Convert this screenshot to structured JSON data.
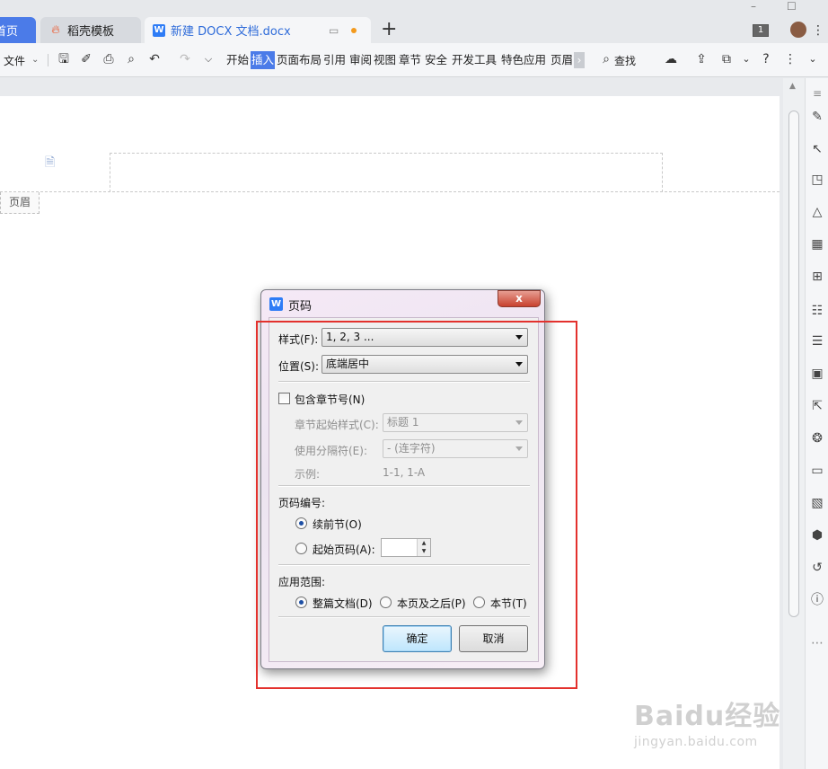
{
  "tabs": {
    "home": "首页",
    "template": "稻壳模板",
    "document": "新建 DOCX 文档.docx",
    "add": "+"
  },
  "titlebar": {
    "minimize": "–",
    "maximize": "☐",
    "badge": "1"
  },
  "ribbon": {
    "file_menu": "文件",
    "menu_tabs": [
      "开始",
      "插入",
      "页面布局",
      "引用",
      "审阅",
      "视图",
      "章节",
      "安全",
      "开发工具",
      "特色应用",
      "页眉"
    ],
    "active_tab": "插入",
    "search": "查找"
  },
  "document": {
    "header_label": "页眉"
  },
  "dialog": {
    "title": "页码",
    "close": "x",
    "style_label": "样式(F):",
    "style_value": "1, 2, 3 ...",
    "position_label": "位置(S):",
    "position_value": "底端居中",
    "include_chapter": "包含章节号(N)",
    "chapter_style_label": "章节起始样式(C):",
    "chapter_style_value": "标题 1",
    "separator_label": "使用分隔符(E):",
    "separator_value": "-    (连字符)",
    "example_label": "示例:",
    "example_value": "1-1, 1-A",
    "numbering_heading": "页码编号:",
    "continue_prev": "续前节(O)",
    "start_at": "起始页码(A):",
    "scope_heading": "应用范围:",
    "scope_whole": "整篇文档(D)",
    "scope_after": "本页及之后(P)",
    "scope_section": "本节(T)",
    "ok": "确定",
    "cancel": "取消"
  },
  "watermark": {
    "main": "Baidu经验",
    "sub": "jingyan.baidu.com"
  }
}
